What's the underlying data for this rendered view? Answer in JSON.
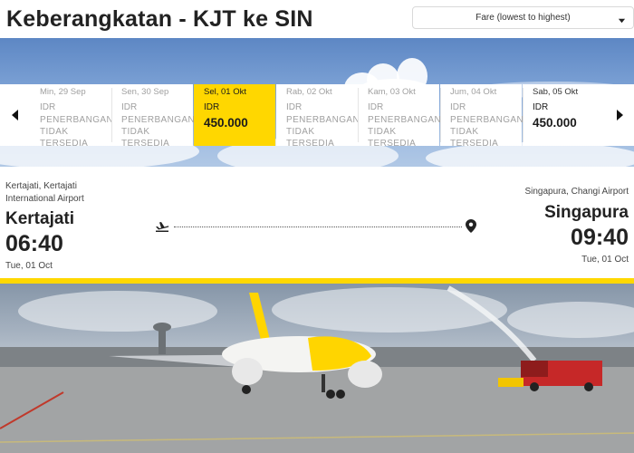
{
  "header": {
    "title": "Keberangkatan - KJT ke SIN",
    "sort_label": "Fare (lowest to highest)"
  },
  "date_strip": {
    "days": [
      {
        "date": "Min, 29 Sep",
        "currency": "IDR",
        "status": "PENERBANGAN TIDAK TERSEDIA"
      },
      {
        "date": "Sen, 30 Sep",
        "currency": "IDR",
        "status": "PENERBANGAN TIDAK TERSEDIA"
      },
      {
        "date": "Sel, 01 Okt",
        "currency": "IDR",
        "price": "450.000",
        "selected": true
      },
      {
        "date": "Rab, 02 Okt",
        "currency": "IDR",
        "status": "PENERBANGAN TIDAK TERSEDIA"
      },
      {
        "date": "Kam, 03 Okt",
        "currency": "IDR",
        "status": "PENERBANGAN TIDAK TERSEDIA"
      },
      {
        "date": "Jum, 04 Okt",
        "currency": "IDR",
        "status": "PENERBANGAN TIDAK TERSEDIA"
      },
      {
        "date": "Sab, 05 Okt",
        "currency": "IDR",
        "price": "450.000"
      }
    ]
  },
  "flight": {
    "departure": {
      "airport": "Kertajati, Kertajati International Airport",
      "city": "Kertajati",
      "time": "06:40",
      "date": "Tue, 01 Oct"
    },
    "arrival": {
      "airport": "Singapura, Changi Airport",
      "city": "Singapura",
      "time": "09:40",
      "date": "Tue, 01 Oct"
    }
  },
  "colors": {
    "accent": "#ffd700",
    "text": "#222222",
    "muted": "#a0a0a0"
  },
  "icons": {
    "left": "chevron-left-icon",
    "right": "chevron-right-icon",
    "sort": "caret-down-icon",
    "departure": "plane-takeoff-icon",
    "arrival": "location-pin-icon"
  }
}
